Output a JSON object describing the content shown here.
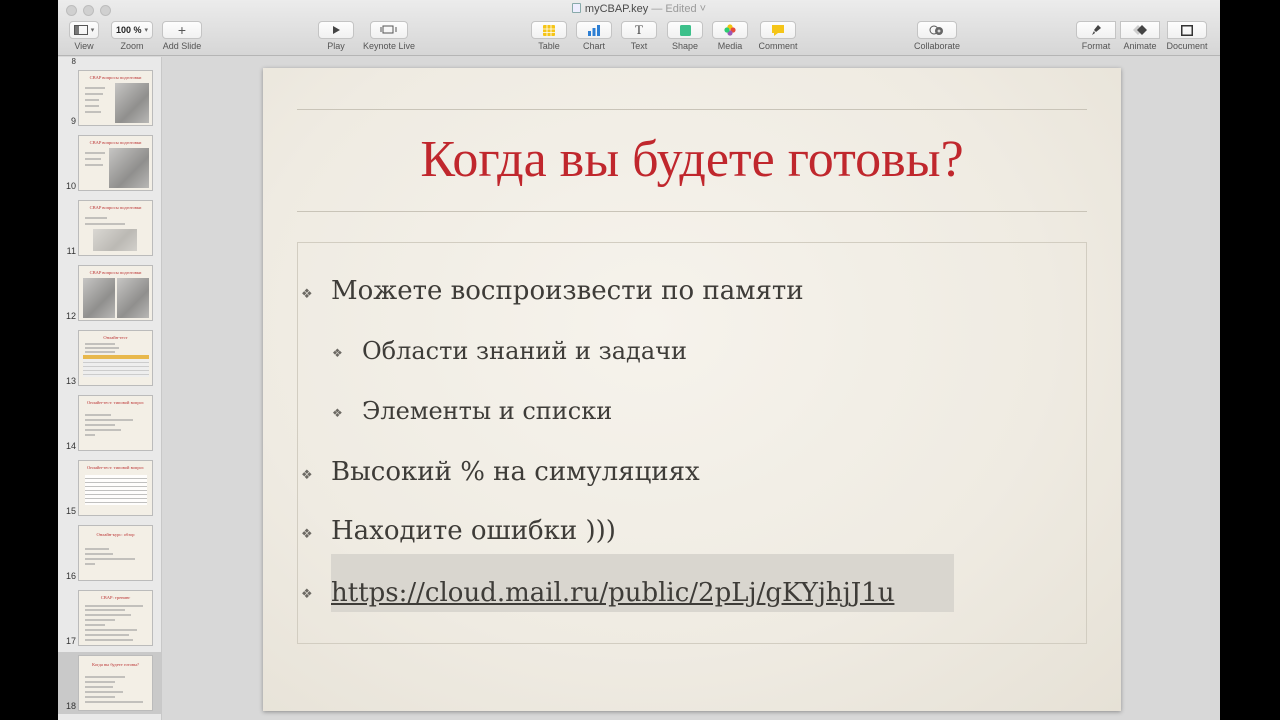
{
  "window": {
    "doc_name": "myCBAP.key",
    "doc_status": "— Edited",
    "doc_status_caret": "˅"
  },
  "toolbar": {
    "view": "View",
    "zoom_label": "Zoom",
    "zoom_value": "100 %",
    "add_slide": "Add Slide",
    "play": "Play",
    "keynote_live": "Keynote Live",
    "table": "Table",
    "chart": "Chart",
    "text": "Text",
    "shape": "Shape",
    "media": "Media",
    "comment": "Comment",
    "collaborate": "Collaborate",
    "format": "Format",
    "animate": "Animate",
    "document": "Document",
    "colors": {
      "table_icon": "#f5c518",
      "chart_icon": "#2d7fd4",
      "shape_icon": "#3cc08a",
      "comment_icon": "#f5c518"
    }
  },
  "sidebar": {
    "top_partial_number": "8",
    "slides": [
      {
        "number": "9",
        "title": "CBAP вопросы подготовки"
      },
      {
        "number": "10",
        "title": "CBAP вопросы подготовки"
      },
      {
        "number": "11",
        "title": "CBAP вопросы подготовки"
      },
      {
        "number": "12",
        "title": "CBAP вопросы подготовки"
      },
      {
        "number": "13",
        "title": "Онлайн-тест"
      },
      {
        "number": "14",
        "title": "Онлайн-тест: типовой вопрос"
      },
      {
        "number": "15",
        "title": "Онлайн-тест: типовой вопрос"
      },
      {
        "number": "16",
        "title": "Онлайн-курс: обзор"
      },
      {
        "number": "17",
        "title": "CBAP: тренинг"
      },
      {
        "number": "18",
        "title": "Когда вы будете готовы?"
      }
    ]
  },
  "slide": {
    "title": "Когда вы будете готовы?",
    "bullets": [
      {
        "text": "Можете воспроизвести по памяти",
        "level": 1
      },
      {
        "text": "Области знаний и задачи",
        "level": 2
      },
      {
        "text": "Элементы и списки",
        "level": 2
      },
      {
        "text": "Высокий % на симуляциях",
        "level": 1
      },
      {
        "text": "Находите ошибки )))",
        "level": 1
      }
    ],
    "link": "https://cloud.mail.ru/public/2pLj/gKYjhjJ1u",
    "bullet_glyph": "❖",
    "title_color": "#c0272d"
  }
}
